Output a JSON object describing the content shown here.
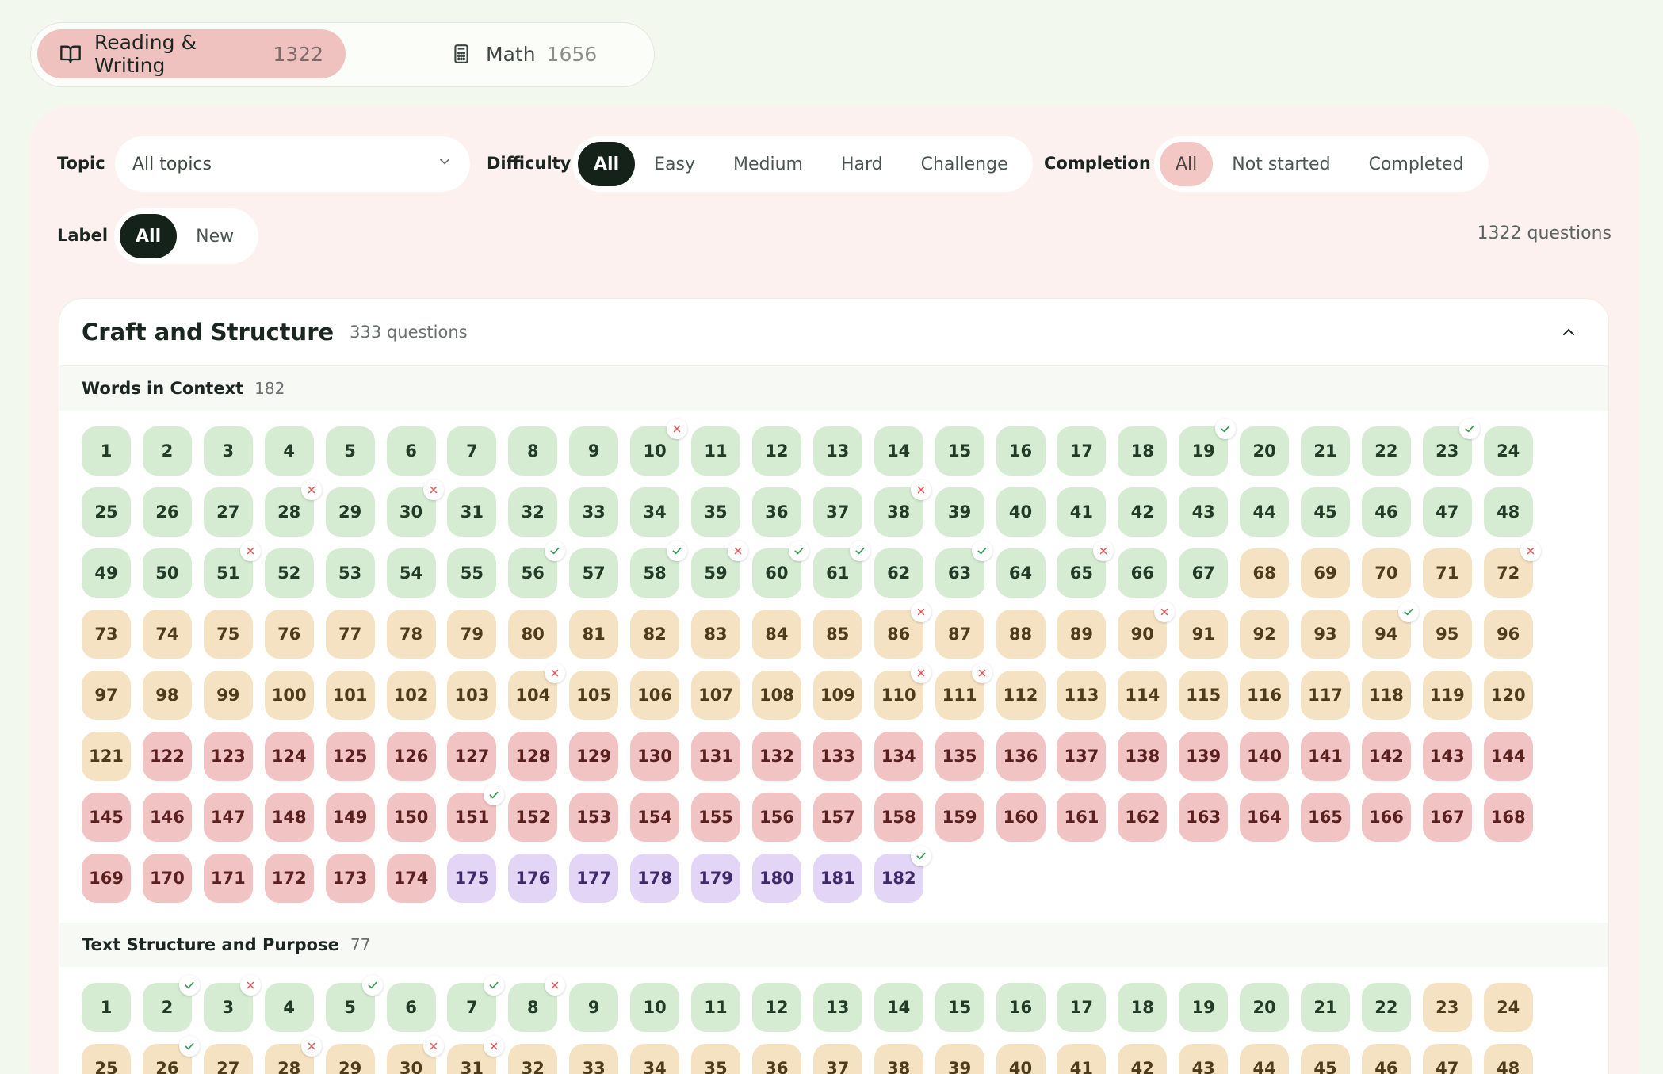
{
  "subject_tabs": [
    {
      "label": "Reading & Writing",
      "count": "1322",
      "icon": "book-open-icon",
      "active": true
    },
    {
      "label": "Math",
      "count": "1656",
      "icon": "calculator-icon",
      "active": false
    }
  ],
  "filters": {
    "topic_label": "Topic",
    "topic_value": "All topics",
    "difficulty_label": "Difficulty",
    "difficulty_options": [
      "All",
      "Easy",
      "Medium",
      "Hard",
      "Challenge"
    ],
    "difficulty_selected": "All",
    "completion_label": "Completion",
    "completion_options": [
      "All",
      "Not started",
      "Completed"
    ],
    "completion_selected": "All",
    "label_label": "Label",
    "label_options": [
      "All",
      "New"
    ],
    "label_selected": "All",
    "question_count": "1322 questions"
  },
  "colors": {
    "easy": "#d5ecd3",
    "medium": "#f5e2c2",
    "hard": "#f2c3c3",
    "challenge": "#e3d5f5",
    "correct": "#3a9a55",
    "incorrect": "#e05555",
    "active_dark": "#152219",
    "active_pink": "#efc2c0"
  },
  "section": {
    "title": "Craft and Structure",
    "count": "333 questions",
    "collapse_icon": "chevron-up-icon",
    "subsections": [
      {
        "title": "Words in Context",
        "count": "182",
        "difficulty_ranges": [
          {
            "level": "easy",
            "from": 1,
            "to": 67
          },
          {
            "level": "medium",
            "from": 68,
            "to": 121
          },
          {
            "level": "hard",
            "from": 122,
            "to": 174
          },
          {
            "level": "challenge",
            "from": 175,
            "to": 182
          }
        ],
        "correct": [
          19,
          23,
          56,
          58,
          60,
          61,
          63,
          94,
          151,
          182
        ],
        "incorrect": [
          10,
          28,
          30,
          38,
          51,
          59,
          65,
          72,
          86,
          90,
          104,
          110,
          111
        ]
      },
      {
        "title": "Text Structure and Purpose",
        "count": "77",
        "difficulty_ranges": [
          {
            "level": "easy",
            "from": 1,
            "to": 22
          },
          {
            "level": "medium",
            "from": 23,
            "to": 48
          }
        ],
        "visible_numbers": [
          1,
          48
        ],
        "correct": [
          2,
          5,
          7,
          26
        ],
        "incorrect": [
          3,
          8,
          28,
          30,
          31
        ]
      }
    ]
  }
}
